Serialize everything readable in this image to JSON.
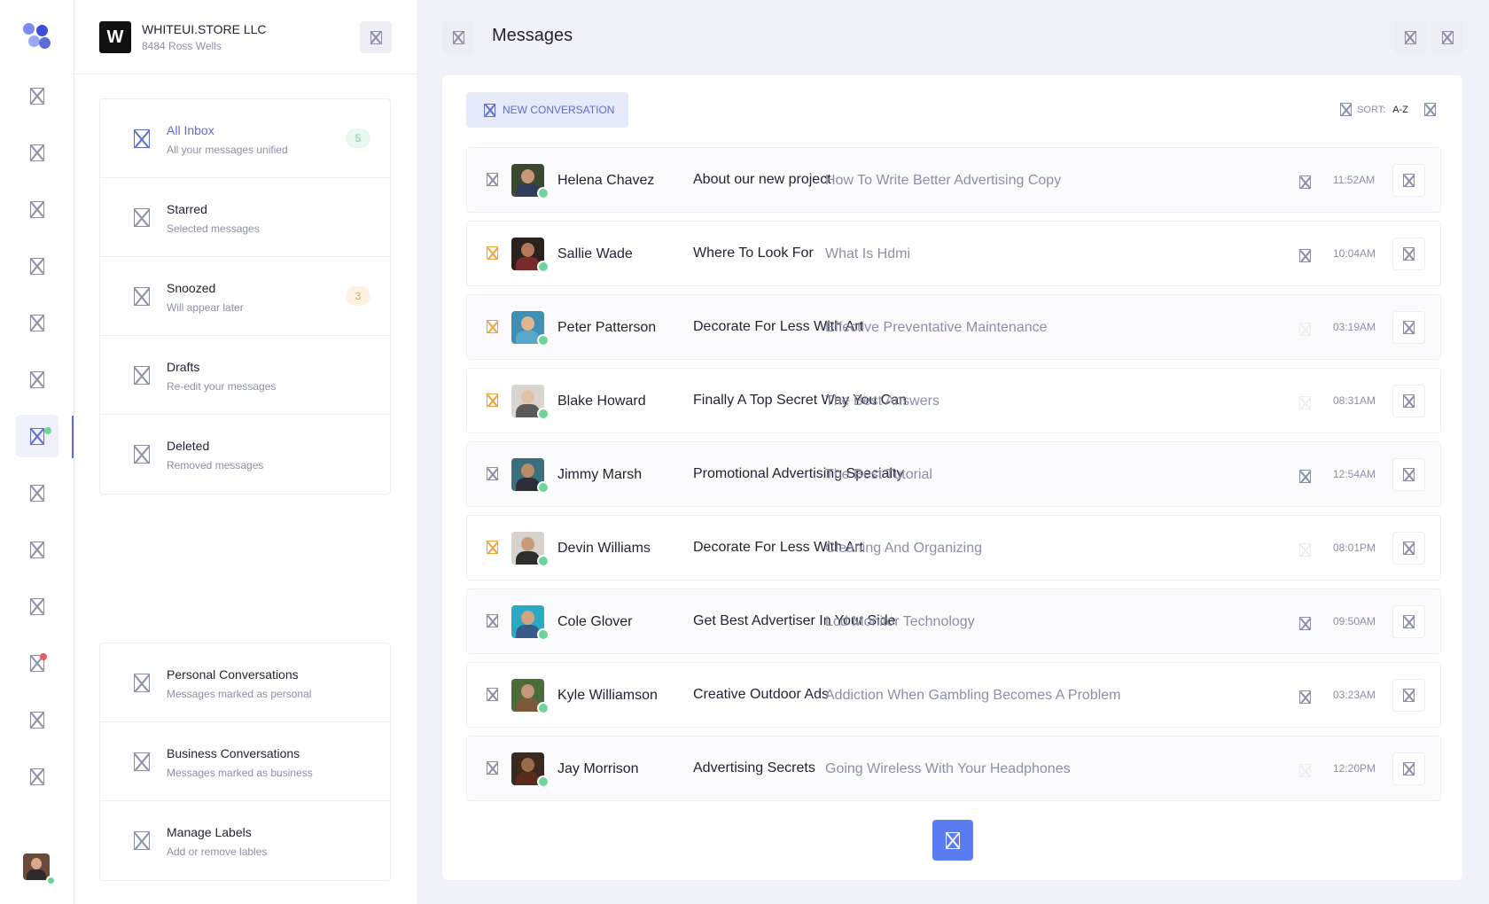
{
  "company": {
    "initial": "W",
    "name": "WHITEUI.STORE LLC",
    "address": "8484 Ross Wells"
  },
  "colors": {
    "accent": "#5b6cd6",
    "primary_button": "#5b7cf0",
    "online": "#6fd49a",
    "warning": "#f0a23a",
    "alert": "#f0556b"
  },
  "rail": {
    "icons": [
      "nav-1-icon",
      "nav-2-icon",
      "nav-3-icon",
      "nav-4-icon",
      "nav-5-icon",
      "nav-6-icon",
      "messages-icon",
      "nav-8-icon",
      "nav-9-icon",
      "nav-10-icon",
      "notifications-icon",
      "nav-12-icon",
      "nav-13-icon"
    ],
    "active_index": 6
  },
  "mailboxes": [
    {
      "title": "All Inbox",
      "subtitle": "All your messages unified",
      "badge": "5"
    },
    {
      "title": "Starred",
      "subtitle": "Selected messages"
    },
    {
      "title": "Snoozed",
      "subtitle": "Will appear later",
      "badge": "3"
    },
    {
      "title": "Drafts",
      "subtitle": "Re-edit your messages"
    },
    {
      "title": "Deleted",
      "subtitle": "Removed messages"
    }
  ],
  "labels": [
    {
      "title": "Personal Conversations",
      "subtitle": "Messages marked as personal"
    },
    {
      "title": "Business Conversations",
      "subtitle": "Messages marked as business"
    },
    {
      "title": "Manage Labels",
      "subtitle": "Add or remove lables"
    }
  ],
  "header": {
    "title": "Messages"
  },
  "toolbar": {
    "new_conversation": "NEW CONVERSATION",
    "sort_label": "SORT:",
    "sort_value": "A-Z"
  },
  "messages": [
    {
      "sender": "Helena Chavez",
      "subject": "About our new project",
      "preview": "How To Write Better Advertising Copy",
      "time": "11:52AM",
      "starred": false,
      "attachment": true
    },
    {
      "sender": "Sallie Wade",
      "subject": "Where To Look For",
      "preview": "What Is Hdmi",
      "time": "10:04AM",
      "starred": true,
      "attachment": true
    },
    {
      "sender": "Peter Patterson",
      "subject": "Decorate For Less With Art",
      "preview": "Effective Preventative Maintenance",
      "time": "03:19AM",
      "starred": true,
      "attachment": false
    },
    {
      "sender": "Blake Howard",
      "subject": "Finally A Top Secret Way You Can",
      "preview": "The Best Answers",
      "time": "08:31AM",
      "starred": true,
      "attachment": false
    },
    {
      "sender": "Jimmy Marsh",
      "subject": "Promotional Advertising Specialty",
      "preview": "The Best Tutorial",
      "time": "12:54AM",
      "starred": false,
      "attachment": true
    },
    {
      "sender": "Devin Williams",
      "subject": "Decorate For Less With Art",
      "preview": "Cleaning And Organizing",
      "time": "08:01PM",
      "starred": true,
      "attachment": false
    },
    {
      "sender": "Cole Glover",
      "subject": "Get Best Advertiser In Your Side",
      "preview": "Lcd Monitor Technology",
      "time": "09:50AM",
      "starred": false,
      "attachment": true
    },
    {
      "sender": "Kyle Williamson",
      "subject": "Creative Outdoor Ads",
      "preview": "Addiction When Gambling Becomes A Problem",
      "time": "03:23AM",
      "starred": false,
      "attachment": true
    },
    {
      "sender": "Jay Morrison",
      "subject": "Advertising Secrets",
      "preview": "Going Wireless With Your Headphones",
      "time": "12:20PM",
      "starred": false,
      "attachment": false
    }
  ]
}
